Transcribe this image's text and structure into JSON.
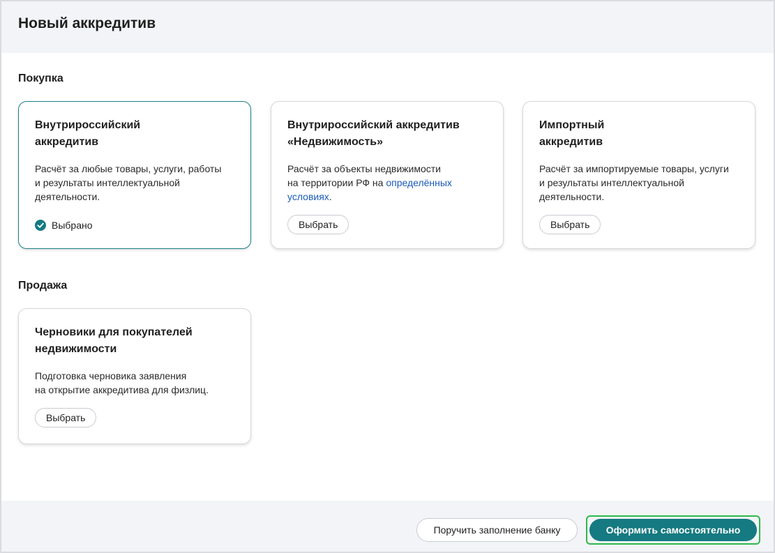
{
  "header": {
    "title": "Новый аккредитив"
  },
  "sections": {
    "purchase": {
      "title": "Покупка",
      "cards": [
        {
          "title_line1": "Внутрироссийский",
          "title_line2": "аккредитив",
          "desc_line1": "Расчёт за любые товары, услуги, работы",
          "desc_line2": "и результаты интеллектуальной",
          "desc_line3": "деятельности.",
          "status": "Выбрано"
        },
        {
          "title_line1": "Внутрироссийский аккредитив",
          "title_line2": "«Недвижимость»",
          "desc_line1": "Расчёт за объекты недвижимости",
          "desc_line2_prefix": "на территории РФ на ",
          "desc_link_part1": "определённых",
          "desc_link_part2": "условиях",
          "desc_suffix": ".",
          "button": "Выбрать"
        },
        {
          "title_line1": "Импортный",
          "title_line2": "аккредитив",
          "desc_line1": "Расчёт за импортируемые товары, услуги",
          "desc_line2": "и результаты интеллектуальной",
          "desc_line3": "деятельности.",
          "button": "Выбрать"
        }
      ]
    },
    "sale": {
      "title": "Продажа",
      "cards": [
        {
          "title_line1": "Черновики для покупателей",
          "title_line2": "недвижимости",
          "desc_line1": "Подготовка черновика заявления",
          "desc_line2": "на открытие аккредитива для физлиц.",
          "button": "Выбрать"
        }
      ]
    }
  },
  "footer": {
    "secondary_button": "Поручить заполнение банку",
    "primary_button": "Оформить самостоятельно"
  },
  "colors": {
    "accent": "#157a81",
    "link": "#1a5bb5",
    "focus_ring": "#2db84d",
    "background_panel": "#f3f4f7"
  },
  "icons": {
    "selected": "check-circle-icon"
  }
}
